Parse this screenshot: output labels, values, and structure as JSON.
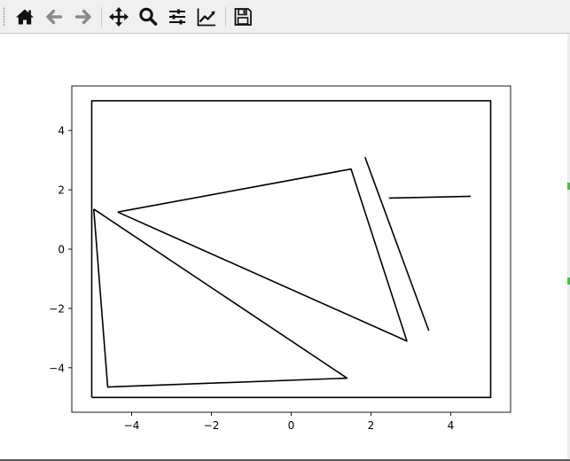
{
  "toolbar": {
    "buttons": [
      {
        "name": "home-icon",
        "tooltip": "Reset original view"
      },
      {
        "name": "back-arrow-icon",
        "tooltip": "Back to previous view"
      },
      {
        "name": "forward-arrow-icon",
        "tooltip": "Forward to next view"
      },
      {
        "name": "pan-move-icon",
        "tooltip": "Pan axes"
      },
      {
        "name": "zoom-magnifier-icon",
        "tooltip": "Zoom to rectangle"
      },
      {
        "name": "configure-subplots-icon",
        "tooltip": "Configure subplots"
      },
      {
        "name": "edit-axis-icon",
        "tooltip": "Edit axis, curve and image parameters"
      },
      {
        "name": "save-disk-icon",
        "tooltip": "Save the figure"
      }
    ]
  },
  "chart_data": {
    "type": "line",
    "title": "",
    "xlabel": "",
    "ylabel": "",
    "xlim": [
      -5.5,
      5.5
    ],
    "ylim": [
      -5.5,
      5.5
    ],
    "grid": false,
    "x_ticks": [
      -4,
      -2,
      0,
      2,
      4
    ],
    "y_ticks": [
      -4,
      -2,
      0,
      2,
      4
    ],
    "x_tick_labels": [
      "−4",
      "−2",
      "0",
      "2",
      "4"
    ],
    "y_tick_labels": [
      "−4",
      "−2",
      "0",
      "2",
      "4"
    ],
    "color": "#000000",
    "series": [
      {
        "x": [
          -5,
          5,
          5,
          -5,
          -5
        ],
        "y": [
          -5,
          -5,
          5,
          5,
          -5
        ]
      },
      {
        "x": [
          -4.35,
          1.5,
          2.9,
          -4.35
        ],
        "y": [
          1.25,
          2.7,
          -3.1,
          1.25
        ]
      },
      {
        "x": [
          -4.95,
          -4.6,
          1.4,
          -4.95
        ],
        "y": [
          1.35,
          -4.65,
          -4.35,
          1.35
        ]
      },
      {
        "x": [
          1.85,
          3.45
        ],
        "y": [
          3.1,
          -2.75
        ]
      },
      {
        "x": [
          2.45,
          4.5
        ],
        "y": [
          1.72,
          1.78
        ]
      }
    ]
  }
}
